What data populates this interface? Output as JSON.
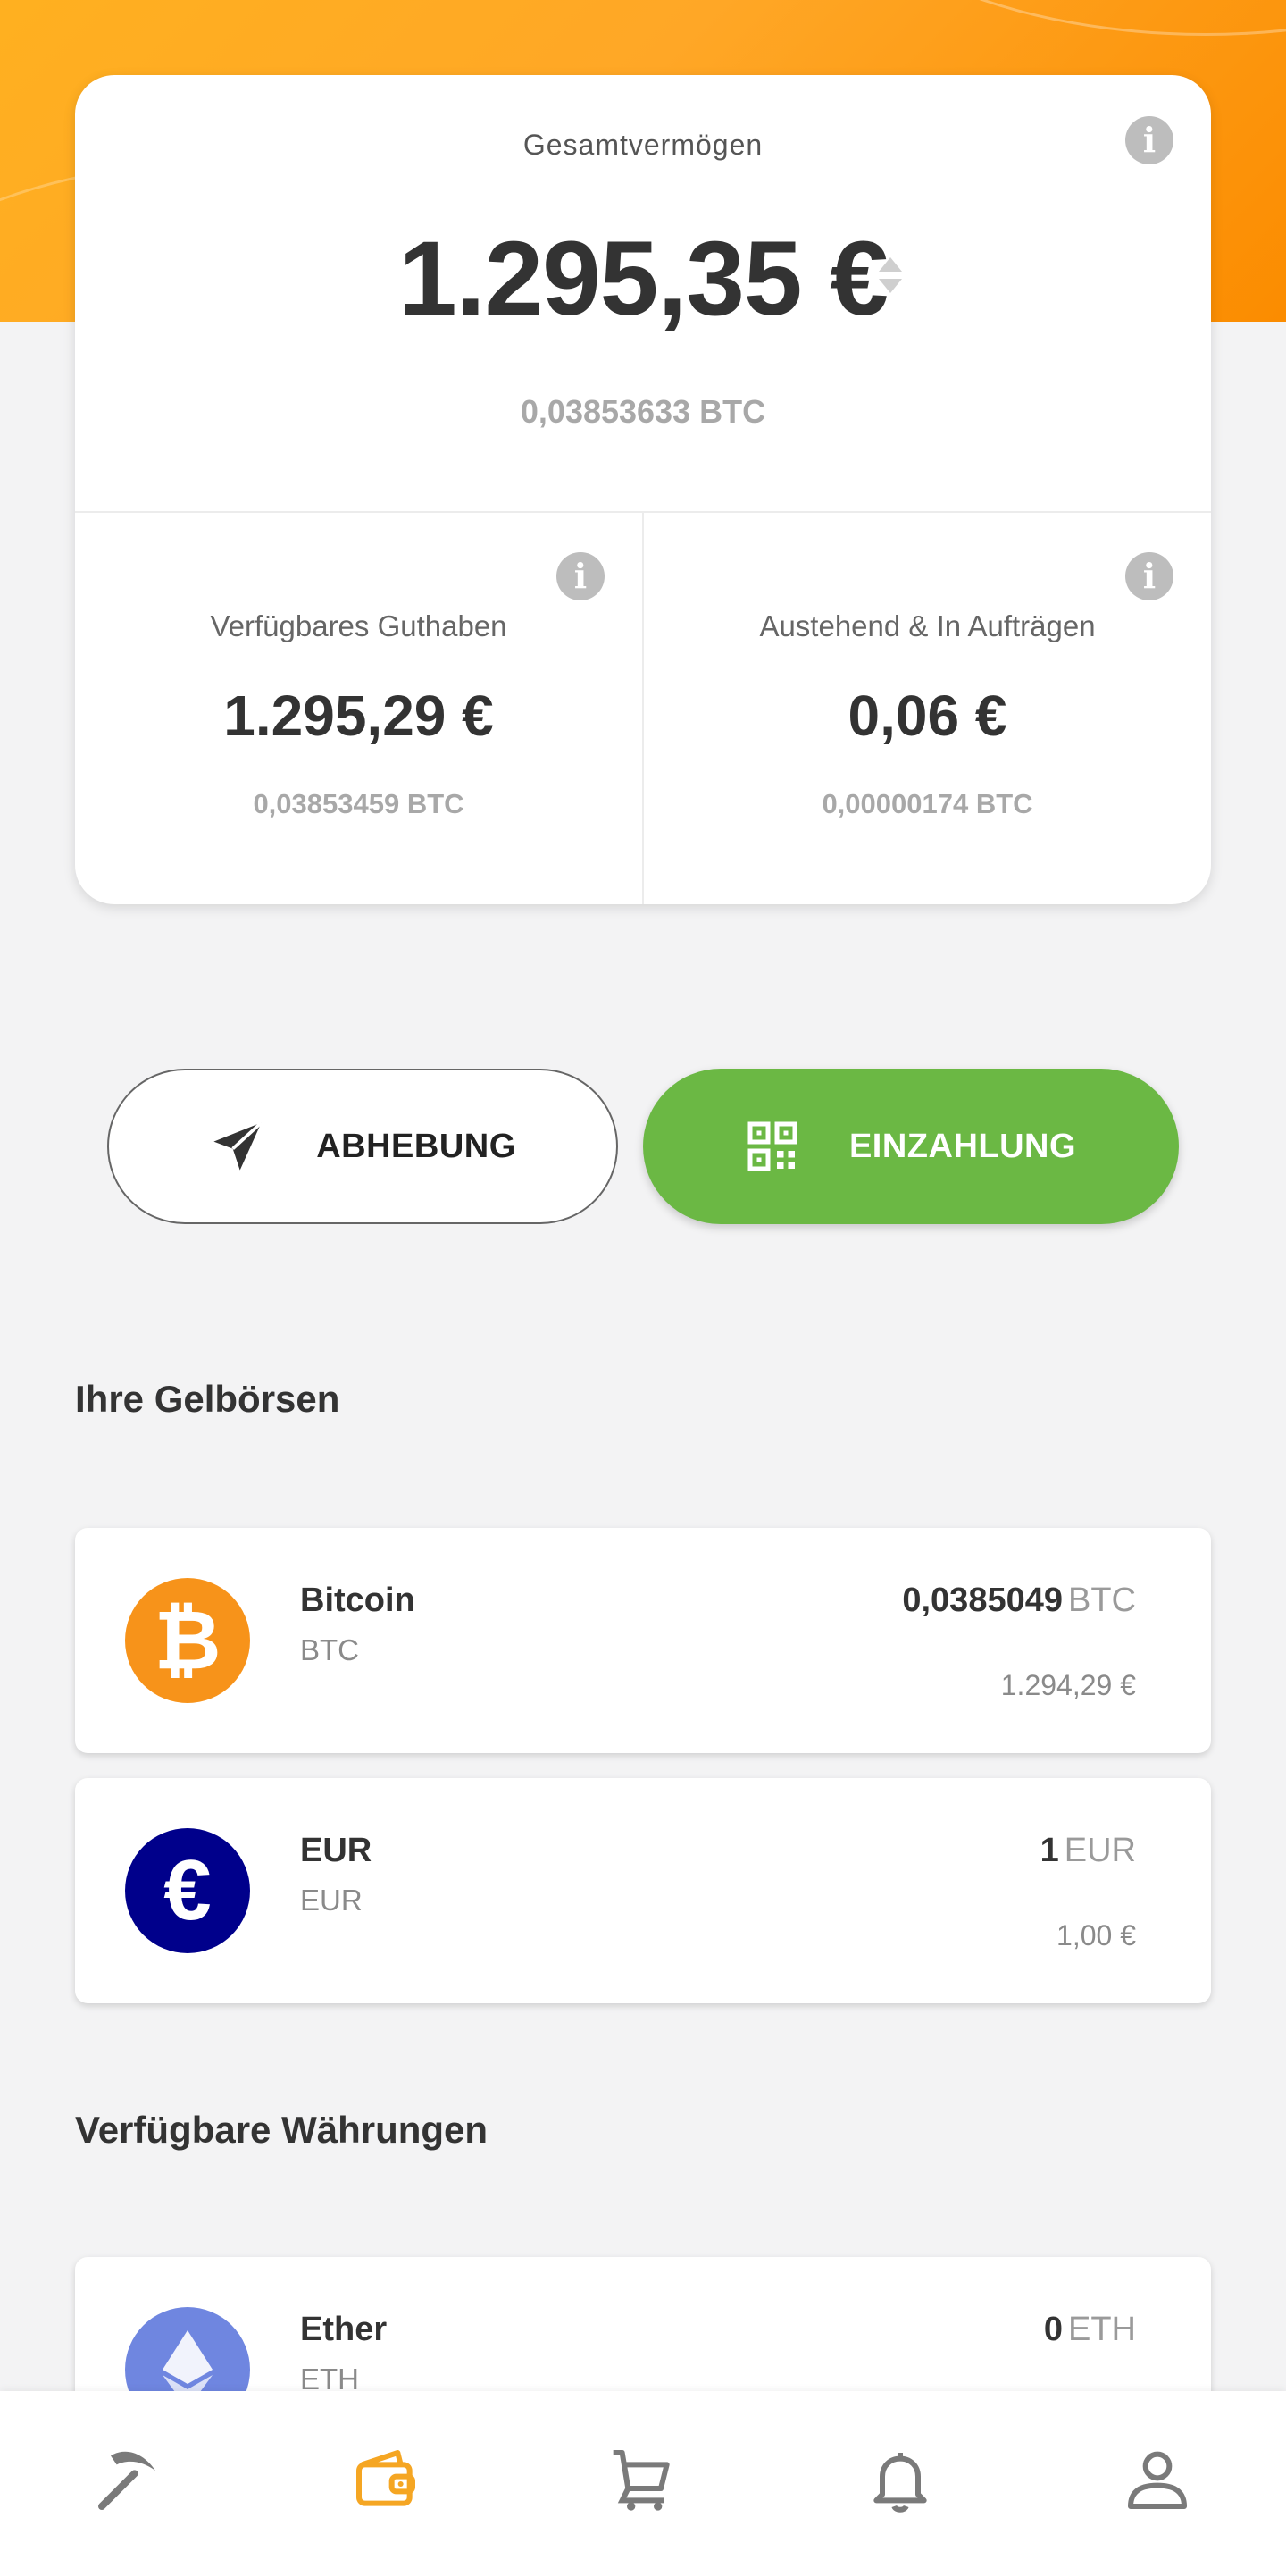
{
  "summary": {
    "total_label": "Gesamtvermögen",
    "total_value": "1.295,35 €",
    "total_btc": "0,03853633 BTC",
    "available": {
      "label": "Verfügbares Guthaben",
      "value": "1.295,29 €",
      "btc": "0,03853459 BTC"
    },
    "pending": {
      "label": "Austehend & In Aufträgen",
      "value": "0,06 €",
      "btc": "0,00000174 BTC"
    },
    "info_glyph": "i"
  },
  "actions": {
    "withdraw_label": "ABHEBUNG",
    "deposit_label": "EINZAHLUNG"
  },
  "wallets_section": {
    "title": "Ihre Gelbörsen",
    "items": [
      {
        "name": "Bitcoin",
        "code": "BTC",
        "amount": "0,0385049",
        "unit": "BTC",
        "fiat": "1.294,29 €",
        "icon": "bitcoin-icon",
        "color": "#f7931a",
        "symbol": "₿"
      },
      {
        "name": "EUR",
        "code": "EUR",
        "amount": "1",
        "unit": "EUR",
        "fiat": "1,00 €",
        "icon": "euro-icon",
        "color": "#00008b",
        "symbol": "€"
      }
    ]
  },
  "available_section": {
    "title": "Verfügbare Währungen",
    "items": [
      {
        "name": "Ether",
        "code": "ETH",
        "amount": "0",
        "unit": "ETH",
        "icon": "ether-icon",
        "color": "#6f86e0"
      }
    ]
  },
  "nav": {
    "items": [
      "pickaxe-icon",
      "wallet-icon",
      "cart-icon",
      "bell-icon",
      "user-icon"
    ],
    "active": "wallet-icon",
    "active_color": "#f5a623",
    "inactive_color": "#7a7a7a"
  },
  "colors": {
    "brand_orange": "#ffa726",
    "deposit_green": "#6bb844"
  }
}
